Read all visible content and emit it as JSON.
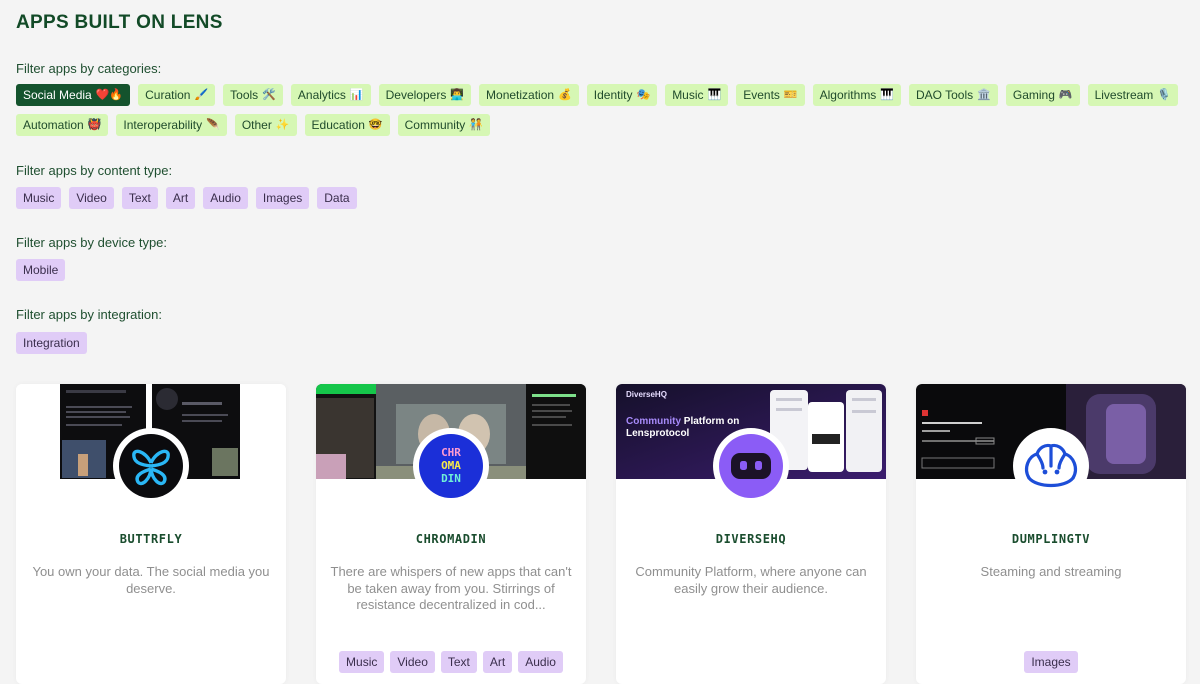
{
  "page_title": "APPS BUILT ON LENS",
  "filters": {
    "categories": {
      "label": "Filter apps by categories:",
      "items": [
        {
          "label": "Social Media",
          "emoji": "❤️🔥",
          "active": true
        },
        {
          "label": "Curation",
          "emoji": "🖌️",
          "active": false
        },
        {
          "label": "Tools",
          "emoji": "🛠️",
          "active": false
        },
        {
          "label": "Analytics",
          "emoji": "📊",
          "active": false
        },
        {
          "label": "Developers",
          "emoji": "👨‍💻",
          "active": false
        },
        {
          "label": "Monetization",
          "emoji": "💰",
          "active": false
        },
        {
          "label": "Identity",
          "emoji": "🎭",
          "active": false
        },
        {
          "label": "Music",
          "emoji": "🎹",
          "active": false
        },
        {
          "label": "Events",
          "emoji": "🎫",
          "active": false
        },
        {
          "label": "Algorithms",
          "emoji": "🎹",
          "active": false
        },
        {
          "label": "DAO Tools",
          "emoji": "🏛️",
          "active": false
        },
        {
          "label": "Gaming",
          "emoji": "🎮",
          "active": false
        },
        {
          "label": "Livestream",
          "emoji": "🎙️",
          "active": false
        },
        {
          "label": "Automation",
          "emoji": "👹",
          "active": false
        },
        {
          "label": "Interoperability",
          "emoji": "🪶",
          "active": false
        },
        {
          "label": "Other",
          "emoji": "✨",
          "active": false
        },
        {
          "label": "Education",
          "emoji": "🤓",
          "active": false
        },
        {
          "label": "Community",
          "emoji": "🧑‍🤝‍🧑",
          "active": false
        }
      ]
    },
    "content_type": {
      "label": "Filter apps by content type:",
      "items": [
        "Music",
        "Video",
        "Text",
        "Art",
        "Audio",
        "Images",
        "Data"
      ]
    },
    "device_type": {
      "label": "Filter apps by device type:",
      "items": [
        "Mobile"
      ]
    },
    "integration": {
      "label": "Filter apps by integration:",
      "items": [
        "Integration"
      ]
    }
  },
  "apps": [
    {
      "name": "BUTTRFLY",
      "description": "You own your data. The social media you deserve.",
      "tags": [],
      "logo_icon": "butterfly-icon"
    },
    {
      "name": "CHROMADIN",
      "description": "There are whispers of new apps that can't be taken away from you. Stirrings of resistance decentralized in cod...",
      "tags": [
        "Music",
        "Video",
        "Text",
        "Art",
        "Audio"
      ],
      "logo_icon": "chromadin-logo-icon",
      "logo_text": [
        "CHR",
        "OMA",
        "DIN"
      ]
    },
    {
      "name": "DIVERSEHQ",
      "description": "Community Platform, where anyone can easily grow their audience.",
      "tags": [],
      "logo_icon": "robot-face-icon",
      "banner_brand": "DiverseHQ",
      "banner_headline_accent": "Community",
      "banner_headline_rest": "Platform on Lensprotocol"
    },
    {
      "name": "DUMPLINGTV",
      "description": "Steaming and streaming",
      "tags": [
        "Images"
      ],
      "logo_icon": "dumpling-icon"
    }
  ],
  "colors": {
    "heading": "#124a27",
    "category_chip": "#d6f7b4",
    "category_chip_active": "#14532d",
    "tag_chip": "#e0ccf7",
    "butterfly_blue": "#2ab7f5",
    "diverse_purple": "#8b5cf6",
    "dumpling_blue": "#1d4ed8"
  }
}
